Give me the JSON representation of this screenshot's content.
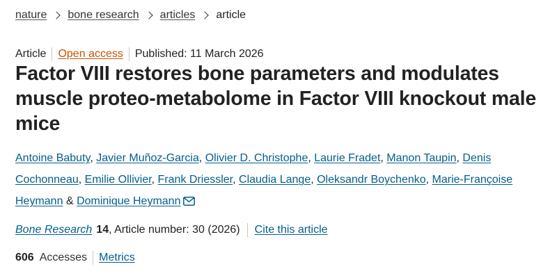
{
  "breadcrumb": {
    "items": [
      "nature",
      "bone research",
      "articles"
    ],
    "current": "article"
  },
  "meta": {
    "type": "Article",
    "access": "Open access",
    "published": "Published: 11 March 2026"
  },
  "title": "Factor VIII restores bone parameters and modulates muscle proteo-metabolome in Factor VIII knockout male mice",
  "authors": [
    "Antoine Babuty",
    "Javier Muñoz-Garcia",
    "Olivier D. Christophe",
    "Laurie Fradet",
    "Manon Taupin",
    "Denis Cochonneau",
    "Emilie Ollivier",
    "Frank Driessler",
    "Claudia Lange",
    "Oleksandr Boychenko",
    "Marie-Françoise Heymann"
  ],
  "authors_conjunction": "&",
  "last_author": "Dominique Heymann",
  "citation": {
    "journal": "Bone Research",
    "volume": "14",
    "article_info": ", Article number: 30 (2026)",
    "cite_link": "Cite this article"
  },
  "metrics": {
    "accesses_count": "606",
    "accesses_label": "Accesses",
    "metrics_link": "Metrics"
  },
  "icons": {
    "mail": "mail-icon"
  },
  "colors": {
    "link": "#025e8d",
    "open_access": "#c65301",
    "text": "#222222"
  }
}
